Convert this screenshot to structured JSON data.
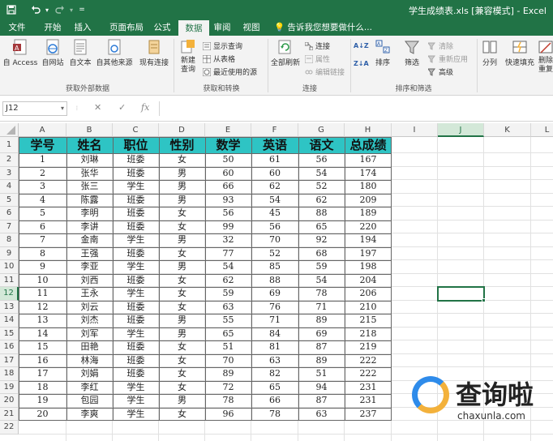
{
  "titlebar": {
    "doc_title": "学生成绩表.xls [兼容模式] - Excel",
    "colors": {
      "accent": "#217346",
      "header_fill": "#2ec4c4"
    }
  },
  "quick_access": [
    {
      "icon": "save-icon",
      "glyph": "🖫"
    },
    {
      "icon": "undo-icon",
      "glyph": "↶"
    },
    {
      "icon": "redo-icon",
      "glyph": "↷"
    },
    {
      "icon": "customize-qat-icon",
      "glyph": "="
    }
  ],
  "tabs": [
    "文件",
    "开始",
    "插入",
    "页面布局",
    "公式",
    "数据",
    "审阅",
    "视图"
  ],
  "active_tab": "数据",
  "tellme": "告诉我您想要做什么...",
  "ribbon": {
    "get_external": {
      "label": "获取外部数据",
      "buttons": [
        "自 Access",
        "自网站",
        "自文本",
        "自其他来源",
        "现有连接"
      ]
    },
    "get_transform": {
      "label": "获取和转换",
      "new_query": "新建\n查询",
      "small": [
        "显示查询",
        "从表格",
        "最近使用的源"
      ]
    },
    "connections": {
      "label": "连接",
      "refresh_all": "全部刷新",
      "small": [
        "连接",
        "属性",
        "编辑链接"
      ]
    },
    "sort_filter": {
      "label": "排序和筛选",
      "sort_az": "A↓Z",
      "sort_za": "Z↓A",
      "sort": "排序",
      "filter": "筛选",
      "small": [
        "清除",
        "重新应用",
        "高级"
      ]
    },
    "tools": {
      "split": "分列",
      "flash_fill": "快速填充",
      "remove_dup": "删除\n重复"
    }
  },
  "formula_bar": {
    "name_box": "J12",
    "cancel": "✕",
    "enter": "✓",
    "fx": "fx",
    "value": ""
  },
  "grid": {
    "columns": [
      "A",
      "B",
      "C",
      "D",
      "E",
      "F",
      "G",
      "H",
      "I",
      "J",
      "K",
      "L"
    ],
    "rows": [
      "1",
      "2",
      "3",
      "4",
      "5",
      "6",
      "7",
      "8",
      "9",
      "10",
      "11",
      "12",
      "13",
      "14",
      "15",
      "16",
      "17",
      "18",
      "19",
      "20",
      "21",
      "22"
    ],
    "active_cell": "J12",
    "headers": [
      "学号",
      "姓名",
      "职位",
      "性别",
      "数学",
      "英语",
      "语文",
      "总成绩"
    ],
    "data": [
      [
        "1",
        "刘琳",
        "班委",
        "女",
        "50",
        "61",
        "56",
        "167"
      ],
      [
        "2",
        "张华",
        "班委",
        "男",
        "60",
        "60",
        "54",
        "174"
      ],
      [
        "3",
        "张三",
        "学生",
        "男",
        "66",
        "62",
        "52",
        "180"
      ],
      [
        "4",
        "陈露",
        "班委",
        "男",
        "93",
        "54",
        "62",
        "209"
      ],
      [
        "5",
        "李明",
        "班委",
        "女",
        "56",
        "45",
        "88",
        "189"
      ],
      [
        "6",
        "李讲",
        "班委",
        "女",
        "99",
        "56",
        "65",
        "220"
      ],
      [
        "7",
        "金南",
        "学生",
        "男",
        "32",
        "70",
        "92",
        "194"
      ],
      [
        "8",
        "王强",
        "班委",
        "女",
        "77",
        "52",
        "68",
        "197"
      ],
      [
        "9",
        "李亚",
        "学生",
        "男",
        "54",
        "85",
        "59",
        "198"
      ],
      [
        "10",
        "刘西",
        "班委",
        "女",
        "62",
        "88",
        "54",
        "204"
      ],
      [
        "11",
        "王永",
        "学生",
        "女",
        "59",
        "69",
        "78",
        "206"
      ],
      [
        "12",
        "刘云",
        "班委",
        "女",
        "63",
        "76",
        "71",
        "210"
      ],
      [
        "13",
        "刘杰",
        "班委",
        "男",
        "55",
        "71",
        "89",
        "215"
      ],
      [
        "14",
        "刘军",
        "学生",
        "男",
        "65",
        "84",
        "69",
        "218"
      ],
      [
        "15",
        "田艳",
        "班委",
        "女",
        "51",
        "81",
        "87",
        "219"
      ],
      [
        "16",
        "林海",
        "班委",
        "女",
        "70",
        "63",
        "89",
        "222"
      ],
      [
        "17",
        "刘娟",
        "班委",
        "女",
        "89",
        "82",
        "51",
        "222"
      ],
      [
        "18",
        "李红",
        "学生",
        "女",
        "72",
        "65",
        "94",
        "231"
      ],
      [
        "19",
        "包园",
        "学生",
        "男",
        "78",
        "66",
        "87",
        "231"
      ],
      [
        "20",
        "李爽",
        "学生",
        "女",
        "96",
        "78",
        "63",
        "237"
      ]
    ]
  },
  "watermark": {
    "brand_cn": "查询啦",
    "brand_en": "chaxunla.com"
  }
}
